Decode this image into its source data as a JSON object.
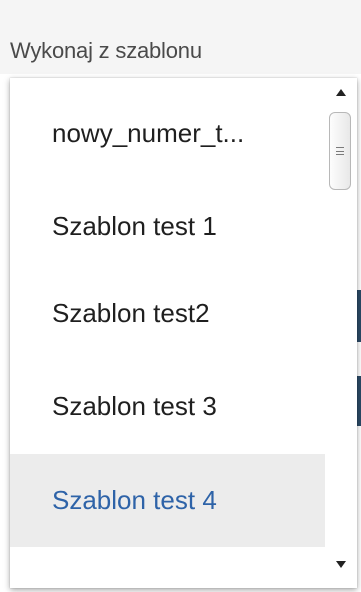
{
  "header": {
    "label": "Wykonaj z szablonu"
  },
  "dropdown": {
    "items": [
      {
        "label": "nowy_numer_t..."
      },
      {
        "label": "Szablon test 1"
      },
      {
        "label": "Szablon test2"
      },
      {
        "label": "Szablon test 3"
      },
      {
        "label": "Szablon test 4",
        "highlighted": true
      }
    ],
    "scroll": {
      "up_icon": "triangle-up-icon",
      "down_icon": "triangle-down-icon",
      "thumb_icon": "grip-lines-icon"
    }
  },
  "colors": {
    "highlight_bg": "#ececec",
    "highlight_text": "#2e63a8",
    "text": "#1f1f1f",
    "header_bg": "#f5f5f5"
  }
}
